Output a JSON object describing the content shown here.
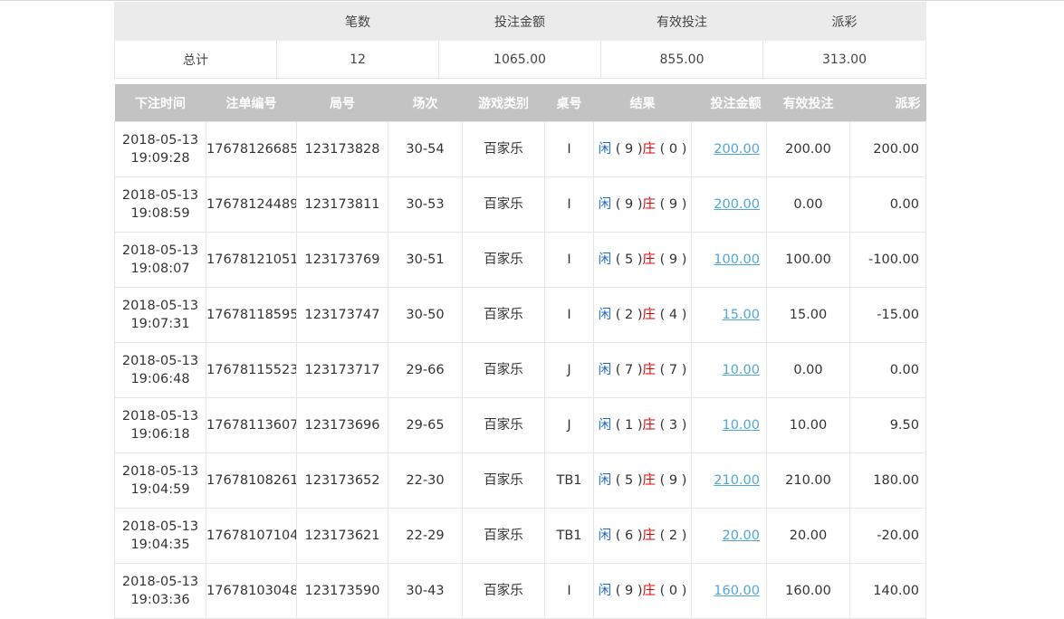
{
  "summary": {
    "headers": [
      "",
      "笔数",
      "投注金额",
      "有效投注",
      "派彩"
    ],
    "row": {
      "label": "总计",
      "count": "12",
      "bet_amount": "1065.00",
      "valid_bet": "855.00",
      "payout": "313.00"
    }
  },
  "records": {
    "headers": [
      "下注时间",
      "注单编号",
      "局号",
      "场次",
      "游戏类别",
      "桌号",
      "结果",
      "投注金额",
      "有效投注",
      "派彩"
    ],
    "player_label": "闲",
    "banker_label": "庄",
    "rows": [
      {
        "date": "2018-05-13",
        "time": "19:09:28",
        "bet_id": "17678126685",
        "round_id": "123173828",
        "session": "30-54",
        "game": "百家乐",
        "table": "I",
        "player": "9",
        "banker": "0",
        "amount": "200.00",
        "valid": "200.00",
        "payout": "200.00",
        "neg": false
      },
      {
        "date": "2018-05-13",
        "time": "19:08:59",
        "bet_id": "17678124489",
        "round_id": "123173811",
        "session": "30-53",
        "game": "百家乐",
        "table": "I",
        "player": "9",
        "banker": "9",
        "amount": "200.00",
        "valid": "0.00",
        "payout": "0.00",
        "neg": false
      },
      {
        "date": "2018-05-13",
        "time": "19:08:07",
        "bet_id": "17678121051",
        "round_id": "123173769",
        "session": "30-51",
        "game": "百家乐",
        "table": "I",
        "player": "5",
        "banker": "9",
        "amount": "100.00",
        "valid": "100.00",
        "payout": "-100.00",
        "neg": true
      },
      {
        "date": "2018-05-13",
        "time": "19:07:31",
        "bet_id": "17678118595",
        "round_id": "123173747",
        "session": "30-50",
        "game": "百家乐",
        "table": "I",
        "player": "2",
        "banker": "4",
        "amount": "15.00",
        "valid": "15.00",
        "payout": "-15.00",
        "neg": true
      },
      {
        "date": "2018-05-13",
        "time": "19:06:48",
        "bet_id": "17678115523",
        "round_id": "123173717",
        "session": "29-66",
        "game": "百家乐",
        "table": "J",
        "player": "7",
        "banker": "7",
        "amount": "10.00",
        "valid": "0.00",
        "payout": "0.00",
        "neg": false
      },
      {
        "date": "2018-05-13",
        "time": "19:06:18",
        "bet_id": "17678113607",
        "round_id": "123173696",
        "session": "29-65",
        "game": "百家乐",
        "table": "J",
        "player": "1",
        "banker": "3",
        "amount": "10.00",
        "valid": "10.00",
        "payout": "9.50",
        "neg": false
      },
      {
        "date": "2018-05-13",
        "time": "19:04:59",
        "bet_id": "17678108261",
        "round_id": "123173652",
        "session": "22-30",
        "game": "百家乐",
        "table": "TB1",
        "player": "5",
        "banker": "9",
        "amount": "210.00",
        "valid": "210.00",
        "payout": "180.00",
        "neg": false
      },
      {
        "date": "2018-05-13",
        "time": "19:04:35",
        "bet_id": "17678107104",
        "round_id": "123173621",
        "session": "22-29",
        "game": "百家乐",
        "table": "TB1",
        "player": "6",
        "banker": "2",
        "amount": "20.00",
        "valid": "20.00",
        "payout": "-20.00",
        "neg": true
      },
      {
        "date": "2018-05-13",
        "time": "19:03:36",
        "bet_id": "17678103048",
        "round_id": "123173590",
        "session": "30-43",
        "game": "百家乐",
        "table": "I",
        "player": "9",
        "banker": "0",
        "amount": "160.00",
        "valid": "160.00",
        "payout": "140.00",
        "neg": false
      }
    ]
  },
  "colors": {
    "summary_header_bg": "#ebebeb",
    "records_header_bg": "#c3c3c3",
    "player_text": "#1e67c8",
    "banker_text": "#e00000",
    "negative_payout": "#e00000",
    "amount_link": "#4fa6d9"
  }
}
